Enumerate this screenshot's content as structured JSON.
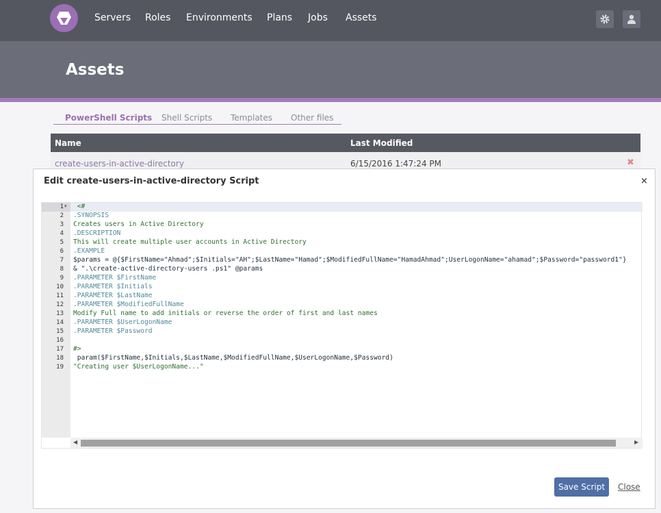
{
  "nav": {
    "items": [
      "Servers",
      "Roles",
      "Environments",
      "Plans",
      "Jobs",
      "Assets"
    ]
  },
  "header": {
    "title": "Assets"
  },
  "tabs": [
    "PowerShell Scripts",
    "Shell Scripts",
    "Templates",
    "Other files"
  ],
  "table": {
    "columns": [
      "Name",
      "Last Modified"
    ],
    "rows": [
      {
        "name": "create-users-in-active-directory",
        "modified": "6/15/2016 1:47:24 PM"
      }
    ]
  },
  "modal": {
    "title": "Edit create-users-in-active-directory Script",
    "close_glyph": "×",
    "save_label": "Save Script",
    "close_label": "Close"
  },
  "editor": {
    "lines": [
      " <#",
      ".SYNOPSIS",
      "Creates users in Active Directory",
      ".DESCRIPTION",
      "This will create multiple user accounts in Active Directory",
      ".EXAMPLE",
      "$params = @{$FirstName=\"Ahmad\";$Initials=\"AH\";$LastName=\"Hamad\";$ModifiedFullName=\"HamadAhmad\";UserLogonName=\"ahamad\";$Password=\"password1\"}",
      "& \".\\create-active-directory-users .ps1\" @params",
      ".PARAMETER $FirstName",
      ".PARAMETER $Initials",
      ".PARAMETER $LastName",
      ".PARAMETER $ModifiedFullName",
      "Modify Full name to add initials or reverse the order of first and last names",
      ".PARAMETER $UserLogonName",
      ".PARAMETER $Password",
      "",
      "#>",
      " param($FirstName,$Initials,$LastName,$ModifiedFullName,$UserLogonName,$Password)",
      "\"Creating user $UserLogonName...\""
    ]
  },
  "colors": {
    "nav_bg": "#545760",
    "header_bg": "#6b6e78",
    "accent": "#a37ab8",
    "primary_button": "#4f6fa6"
  }
}
